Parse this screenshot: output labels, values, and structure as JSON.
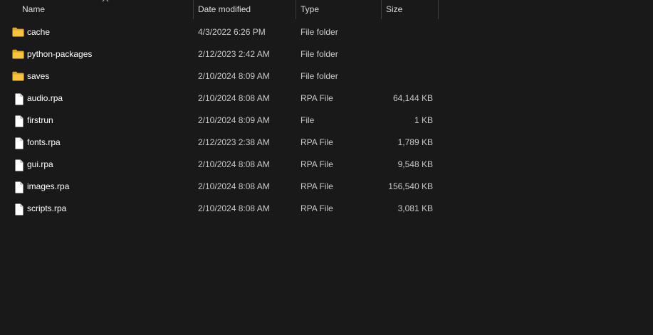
{
  "columns": {
    "name": "Name",
    "date": "Date modified",
    "type": "Type",
    "size": "Size"
  },
  "colors": {
    "background": "#191919",
    "folder": "#F8C33F",
    "text": "#FFFFFF",
    "secondary_text": "#C8C8C8"
  },
  "files": [
    {
      "name": "cache",
      "date": "4/3/2022 6:26 PM",
      "type": "File folder",
      "size": "",
      "icon": "folder-icon"
    },
    {
      "name": "python-packages",
      "date": "2/12/2023 2:42 AM",
      "type": "File folder",
      "size": "",
      "icon": "folder-icon"
    },
    {
      "name": "saves",
      "date": "2/10/2024 8:09 AM",
      "type": "File folder",
      "size": "",
      "icon": "folder-icon"
    },
    {
      "name": "audio.rpa",
      "date": "2/10/2024 8:08 AM",
      "type": "RPA File",
      "size": "64,144 KB",
      "icon": "file-icon"
    },
    {
      "name": "firstrun",
      "date": "2/10/2024 8:09 AM",
      "type": "File",
      "size": "1 KB",
      "icon": "file-icon"
    },
    {
      "name": "fonts.rpa",
      "date": "2/12/2023 2:38 AM",
      "type": "RPA File",
      "size": "1,789 KB",
      "icon": "file-icon"
    },
    {
      "name": "gui.rpa",
      "date": "2/10/2024 8:08 AM",
      "type": "RPA File",
      "size": "9,548 KB",
      "icon": "file-icon"
    },
    {
      "name": "images.rpa",
      "date": "2/10/2024 8:08 AM",
      "type": "RPA File",
      "size": "156,540 KB",
      "icon": "file-icon"
    },
    {
      "name": "scripts.rpa",
      "date": "2/10/2024 8:08 AM",
      "type": "RPA File",
      "size": "3,081 KB",
      "icon": "file-icon"
    }
  ]
}
